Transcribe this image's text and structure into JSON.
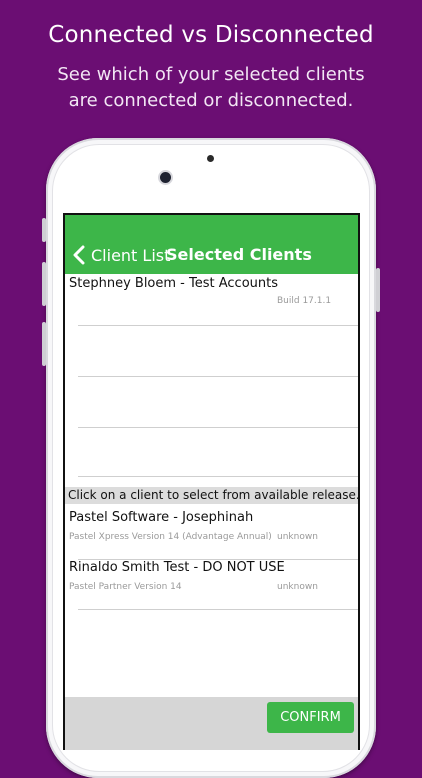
{
  "promo": {
    "title": "Connected vs Disconnected",
    "subtitle_line1": "See which of your selected clients",
    "subtitle_line2": "are connected or disconnected."
  },
  "navbar": {
    "back_label": "Client List",
    "title": "Selected Clients",
    "color": "#3db649"
  },
  "selected_clients": [
    {
      "name": "Stephney Bloem  -  Test Accounts",
      "build": "Build  17.1.1"
    }
  ],
  "section_header": "Click on a client to select from available release.",
  "available_clients": [
    {
      "name": "Pastel Software - Josephinah",
      "version": "Pastel Xpress Version 14 (Advantage Annual)",
      "status": "unknown"
    },
    {
      "name": "Rinaldo Smith Test - DO NOT USE",
      "version": "Pastel Partner Version 14",
      "status": "unknown"
    }
  ],
  "footer": {
    "confirm_label": "CONFIRM"
  },
  "icons": {
    "back": "chevron-left-icon"
  },
  "colors": {
    "background": "#6b0e73",
    "accent": "#3db649"
  }
}
